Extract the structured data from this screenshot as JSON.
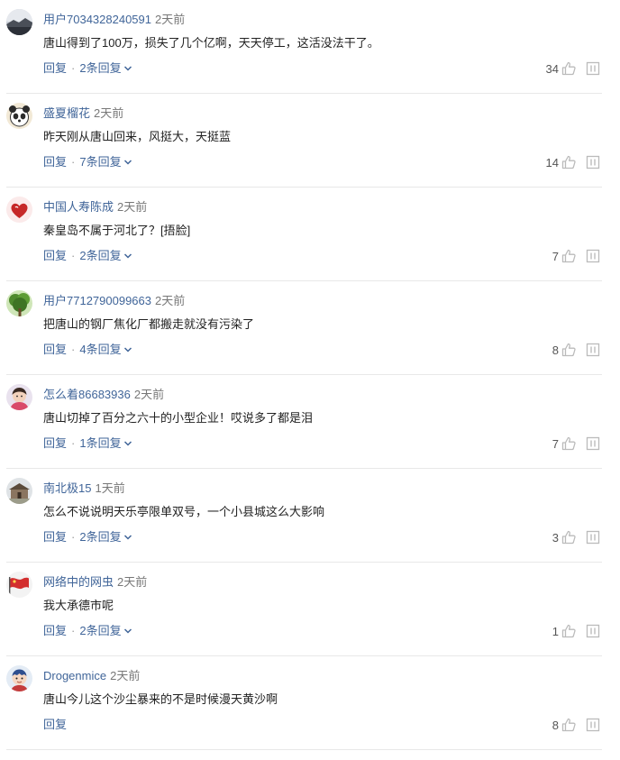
{
  "comments": [
    {
      "avatar_icon": "landscape-dusk-avatar",
      "username": "用户7034328240591",
      "time": "2天前",
      "text": "唐山得到了100万，损失了几个亿啊，天天停工，这活没法干了。",
      "reply_label": "回复",
      "separator": "·",
      "replies_label": "2条回复",
      "likes": "34"
    },
    {
      "avatar_icon": "panda-avatar",
      "username": "盛夏榴花",
      "time": "2天前",
      "text": "昨天刚从唐山回来，风挺大，天挺蓝",
      "reply_label": "回复",
      "separator": "·",
      "replies_label": "7条回复",
      "likes": "14"
    },
    {
      "avatar_icon": "red-heart-avatar",
      "username": "中国人寿陈成",
      "time": "2天前",
      "text": "秦皇岛不属于河北了？[捂脸]",
      "reply_label": "回复",
      "separator": "·",
      "replies_label": "2条回复",
      "likes": "7"
    },
    {
      "avatar_icon": "green-tree-avatar",
      "username": "用户7712790099663",
      "time": "2天前",
      "text": "把唐山的钢厂焦化厂都搬走就没有污染了",
      "reply_label": "回复",
      "separator": "·",
      "replies_label": "4条回复",
      "likes": "8"
    },
    {
      "avatar_icon": "child-portrait-avatar",
      "username": "怎么着86683936",
      "time": "2天前",
      "text": "唐山切掉了百分之六十的小型企业！哎说多了都是泪",
      "reply_label": "回复",
      "separator": "·",
      "replies_label": "1条回复",
      "likes": "7"
    },
    {
      "avatar_icon": "temple-building-avatar",
      "username": "南北极15",
      "time": "1天前",
      "text": "怎么不说说明天乐亭限单双号，一个小县城这么大影响",
      "reply_label": "回复",
      "separator": "·",
      "replies_label": "2条回复",
      "likes": "3"
    },
    {
      "avatar_icon": "flag-avatar",
      "username": "网络中的网虫",
      "time": "2天前",
      "text": "我大承德市呢",
      "reply_label": "回复",
      "separator": "·",
      "replies_label": "2条回复",
      "likes": "1"
    },
    {
      "avatar_icon": "cartoon-character-avatar",
      "username": "Drogenmice",
      "time": "2天前",
      "text": "唐山今儿这个沙尘暴来的不是时候漫天黄沙啊",
      "reply_label": "回复",
      "separator": "",
      "replies_label": "",
      "likes": "8"
    }
  ],
  "colors": {
    "username": "#406599",
    "link": "#406599",
    "text": "#222222",
    "meta": "#777777",
    "icon": "#bbbbbb",
    "divider": "#e8e8e8"
  },
  "icons": {
    "like": "thumbs-up-icon",
    "report": "report-icon",
    "expand": "chevron-down-icon"
  }
}
